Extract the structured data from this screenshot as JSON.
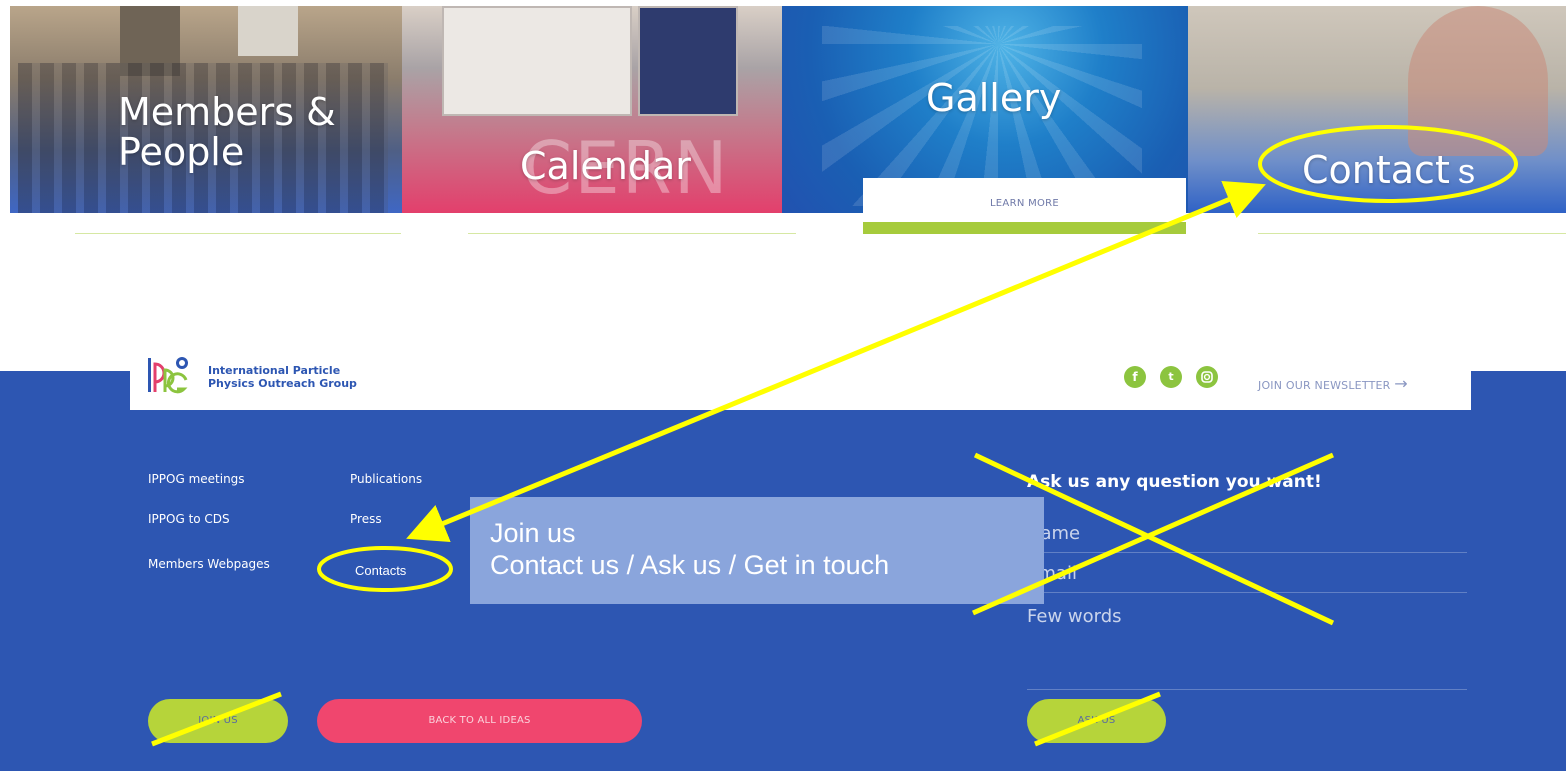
{
  "tiles": [
    {
      "title": "Members & People"
    },
    {
      "title": "Calendar"
    },
    {
      "title": "Gallery",
      "button": "LEARN MORE"
    },
    {
      "title": "Contact"
    }
  ],
  "annotation_letter": "s",
  "footer": {
    "org_line1": "International Particle",
    "org_line2": "Physics Outreach Group",
    "newsletter": "JOIN OUR NEWSLETTER",
    "links_col1": [
      "IPPOG meetings",
      "IPPOG to CDS",
      "Members Webpages"
    ],
    "links_col2": [
      "Publications",
      "Press",
      "Contacts"
    ],
    "form_title": "Ask us any question you want!",
    "form_fields": [
      "Name",
      "Email",
      "Few words"
    ],
    "join_label": "JOIN US",
    "back_label": "BACK TO ALL IDEAS",
    "ask_label": "ASK US"
  },
  "callout": {
    "line1": "Join us",
    "line2": "Contact us / Ask us / Get in touch"
  },
  "colors": {
    "footer_blue": "#2d56b2",
    "lime": "#b6d43a",
    "pink": "#f0466e",
    "annotation_yellow": "#ffff00",
    "callout_bg": "#8aa5dc"
  }
}
